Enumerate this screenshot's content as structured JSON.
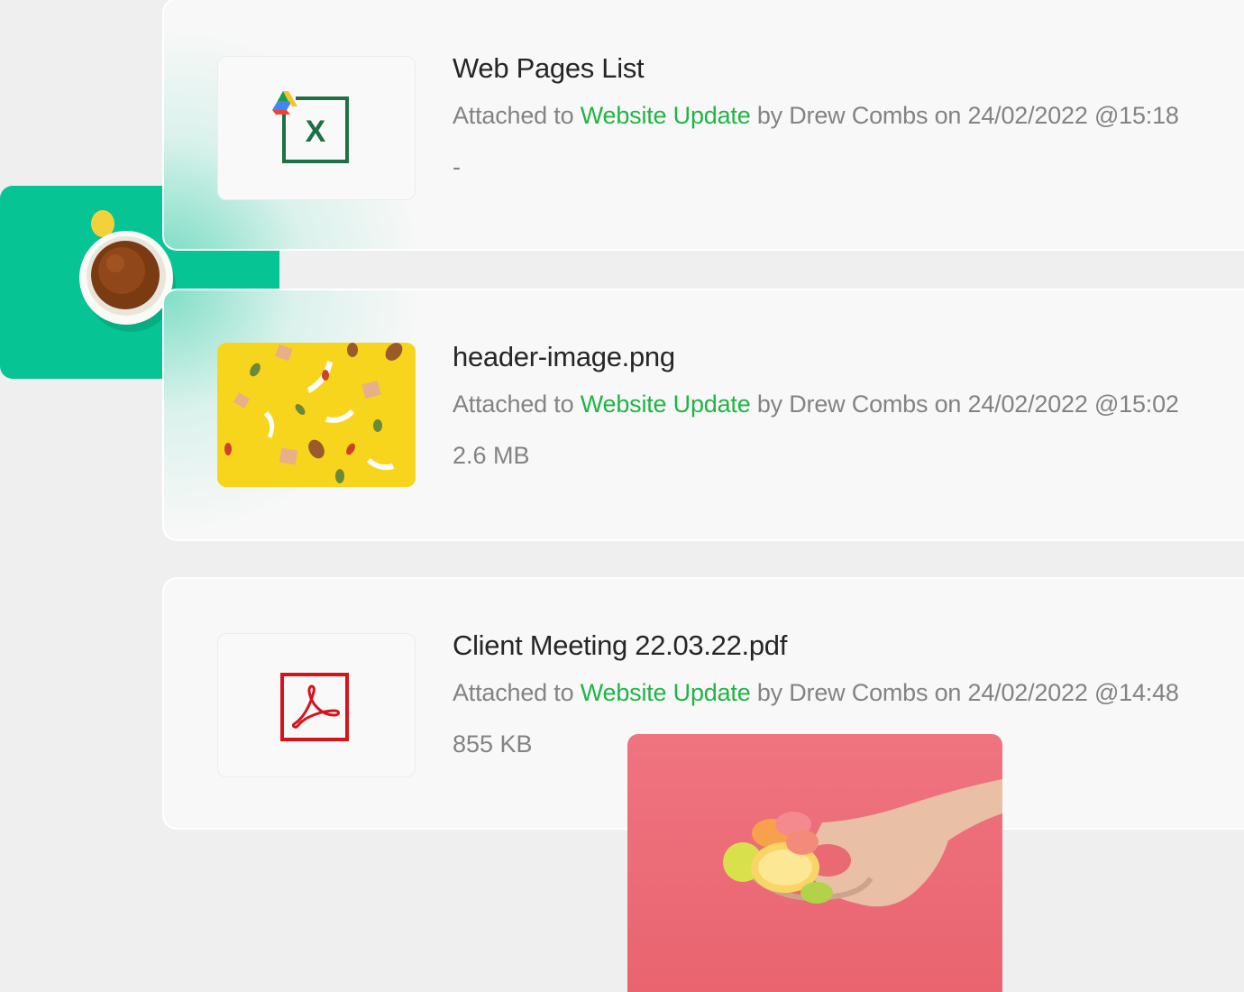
{
  "files": [
    {
      "name": "Web Pages List",
      "attached_prefix": "Attached to",
      "project": "Website Update",
      "attached_suffix": "by Drew Combs on 24/02/2022 @15:18",
      "size": "-",
      "thumb_icon": "google-drive-excel-icon"
    },
    {
      "name": "header-image.png",
      "attached_prefix": "Attached to",
      "project": "Website Update",
      "attached_suffix": "by Drew Combs on 24/02/2022 @15:02",
      "size": "2.6 MB",
      "thumb_icon": "yellow-snacks-photo"
    },
    {
      "name": "Client Meeting 22.03.22.pdf",
      "attached_prefix": "Attached to",
      "project": "Website Update",
      "attached_suffix": "by Drew Combs on 24/02/2022 @14:48",
      "size": "855 KB",
      "thumb_icon": "pdf-icon"
    }
  ],
  "colors": {
    "link": "#20b445",
    "accent_green": "#06c494",
    "excel_green": "#1e7145",
    "pdf_red": "#d6121b",
    "photo_pink": "#ec6f7c",
    "photo_yellow": "#f7d51d"
  }
}
